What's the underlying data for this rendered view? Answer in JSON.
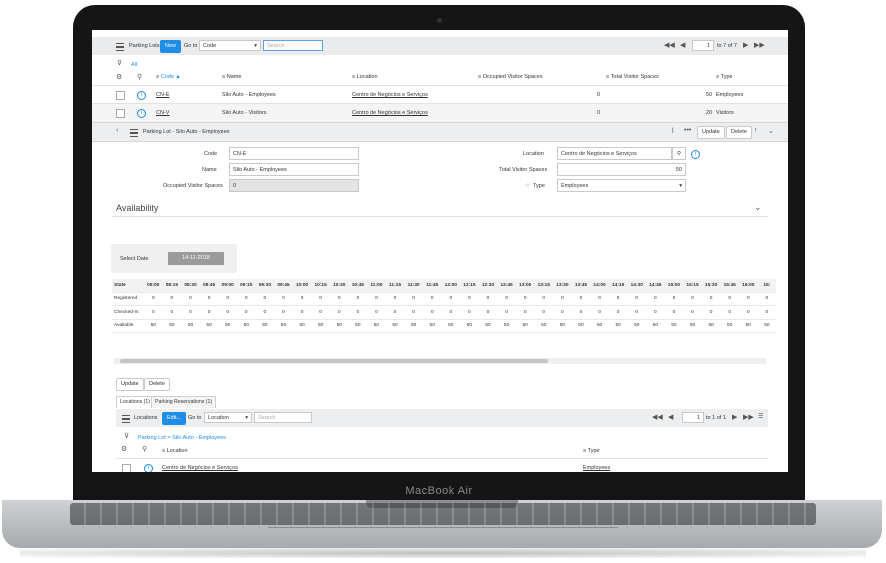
{
  "device_label": "MacBook Air",
  "list": {
    "title": "Parking Lots",
    "new_label": "New",
    "goto_label": "Go to",
    "goto_field": "Code",
    "search_placeholder": "Search",
    "page_current": "1",
    "page_total": "to 7 of 7",
    "filter_label": "All",
    "columns": [
      "Code ▲",
      "Name",
      "Location",
      "Occupied Visitor Spaces",
      "Total Visitor Spaces",
      "Type"
    ],
    "rows": [
      {
        "code": "CN-E",
        "name": "Silo Auto - Employees",
        "location": "Centro de Negócios e Serviços",
        "occupied": "0",
        "total": "50",
        "type": "Employees"
      },
      {
        "code": "CN-V",
        "name": "Silo Auto - Visitors",
        "location": "Centro de Negócios e Serviços",
        "occupied": "0",
        "total": "20",
        "type": "Visitors"
      }
    ]
  },
  "form": {
    "title": "Parking Lot - Silo Auto - Employees",
    "update_label": "Update",
    "delete_label": "Delete",
    "code_label": "Code",
    "code_value": "CN-E",
    "name_label": "Name",
    "name_value": "Silo Auto - Employees",
    "occupied_label": "Occupied Visitor Spaces",
    "occupied_value": "0",
    "location_label": "Location",
    "location_value": "Centro de Negócios e Serviços",
    "total_label": "Total Visitor Spaces",
    "total_value": "50",
    "type_label": "Type",
    "type_value": "Employees"
  },
  "availability": {
    "title": "Availability",
    "select_date_label": "Select Date",
    "date_value": "14-11-2018",
    "row_labels": [
      "State",
      "Registered",
      "Checked-In",
      "Available"
    ],
    "times": [
      "08:00",
      "08:15",
      "08:30",
      "08:45",
      "09:00",
      "09:15",
      "09:30",
      "09:45",
      "10:00",
      "10:15",
      "10:30",
      "10:45",
      "11:00",
      "11:15",
      "11:30",
      "11:45",
      "12:00",
      "12:15",
      "12:30",
      "12:45",
      "13:00",
      "13:15",
      "13:30",
      "13:45",
      "14:00",
      "14:15",
      "14:30",
      "14:45",
      "15:00",
      "15:15",
      "15:30",
      "15:45",
      "16:00",
      "16:"
    ],
    "registered": "0",
    "checked_in": "0",
    "available": "50"
  },
  "related": {
    "update_label": "Update",
    "delete_label": "Delete",
    "tabs": [
      "Locations (1)",
      "Parking Reservations (1)"
    ],
    "list_title": "Locations",
    "edit_label": "Edit...",
    "goto_label": "Go to",
    "goto_field": "Location",
    "search_placeholder": "Search",
    "page_current": "1",
    "page_total": "to 1 of 1",
    "breadcrumb": "Parking Lot = Silo Auto - Employees",
    "columns": [
      "Location",
      "Type"
    ],
    "rows": [
      {
        "location": "Centro de Negócios e Serviços",
        "type": "Employees"
      }
    ]
  }
}
